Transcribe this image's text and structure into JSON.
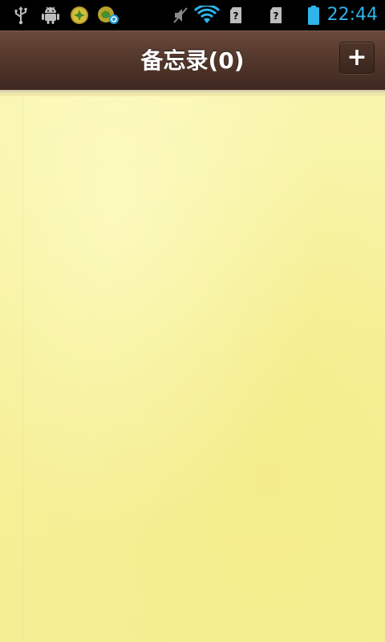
{
  "status_bar": {
    "time": "22:44",
    "time_color": "#2fb4ea",
    "icons": [
      "usb-icon",
      "android-debug-icon",
      "app-notification-icon",
      "app-sync-notification-icon",
      "muted-icon",
      "wifi-icon",
      "no-sim-icon",
      "no-sim-icon",
      "battery-icon"
    ]
  },
  "header": {
    "title": "备忘录(0)",
    "add_label": "+"
  },
  "theme": {
    "header_color": "#55382c",
    "paper_color": "#f7f29b"
  }
}
